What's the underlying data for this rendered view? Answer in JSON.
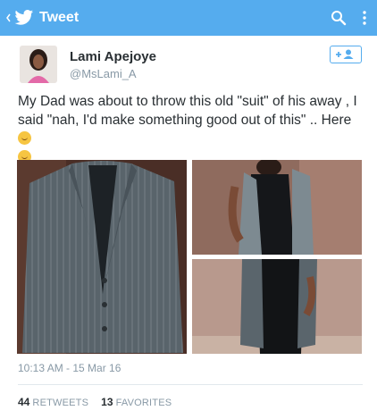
{
  "appbar": {
    "title": "Tweet",
    "color": "#55acee"
  },
  "user": {
    "name": "Lami Apejoye",
    "handle": "@MsLami_A"
  },
  "tweet": {
    "line1": "My Dad was about to throw this old \"suit\" of his away , I",
    "line2": "said \"nah, I'd make something good out of this\" .. Here"
  },
  "photos": [
    {
      "description": "grey pinstripe suit jacket on hanger"
    },
    {
      "description": "sleeveless vest over black dress, side view"
    },
    {
      "description": "sleeveless vest over black dress, front view"
    }
  ],
  "meta": {
    "timestamp": "10:13 AM - 15 Mar 16"
  },
  "stats": {
    "retweets_count": "44",
    "retweets_label": "RETWEETS",
    "favorites_count": "13",
    "favorites_label": "FAVORITES"
  }
}
